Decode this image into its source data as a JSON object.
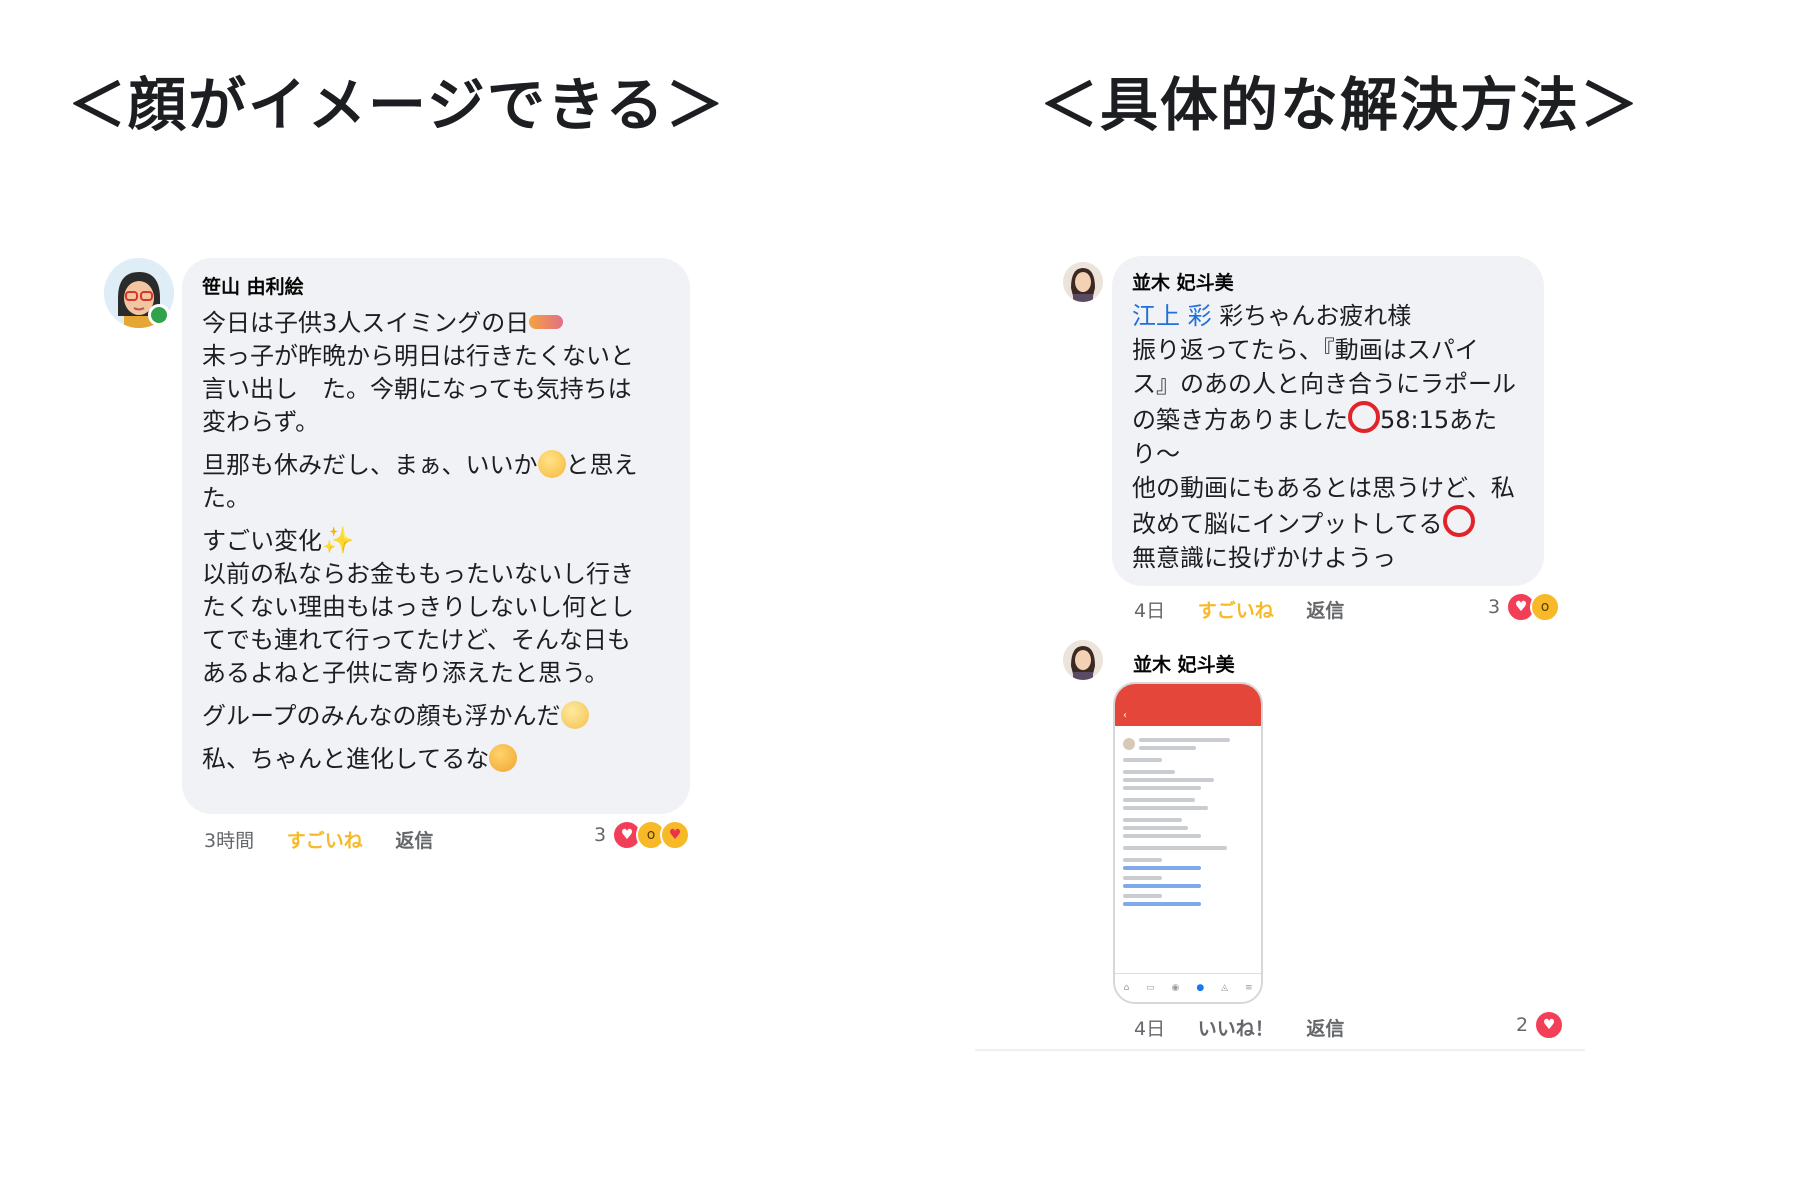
{
  "headings": {
    "left": "＜顔がイメージできる＞",
    "right": "＜具体的な解決方法＞"
  },
  "left_comment": {
    "author": "笹山 由利絵",
    "p1_l1": "今日は子供3人スイミングの日",
    "p1_l2": "末っ子が昨晩から明日は行きたくないと",
    "p1_l3": "言い出し　た。今朝になっても気持ちは",
    "p1_l4": "変わらず。",
    "p2_a": "旦那も休みだし、まぁ、いいか",
    "p2_b": "と思え",
    "p2_c": "た。",
    "p3_a": "すごい変化",
    "p3_spark": "✨",
    "p3_l2": "以前の私ならお金ももったいないし行き",
    "p3_l3": "たくない理由もはっきりしないし何とし",
    "p3_l4": "てでも連れて行ってたけど、そんな日も",
    "p3_l5": "あるよねと子供に寄り添えたと思う。",
    "p4": "グループのみんなの顔も浮かんだ",
    "p5": "私、ちゃんと進化してるな",
    "time": "3時間",
    "like": "すごいね",
    "reply": "返信",
    "reaction_count": "3"
  },
  "right_comment1": {
    "author": "並木 妃斗美",
    "mention": "江上 彩",
    "l1_rest": " 彩ちゃんお疲れ様",
    "l2": "振り返ってたら、『動画はスパイ",
    "l3": "ス』のあの人と向き合うにラポール",
    "l4_a": "の築き方ありました",
    "l4_b": "58:15あた",
    "l5": "り〜",
    "l6": "他の動画にもあるとは思うけど、私",
    "l7": "改めて脳にインプットしてる",
    "l8": "無意識に投げかけようっ",
    "time": "4日",
    "like": "すごいね",
    "reply": "返信",
    "reaction_count": "3"
  },
  "right_comment2": {
    "author": "並木 妃斗美",
    "time": "4日",
    "like": "いいね！",
    "reply": "返信",
    "reaction_count": "2"
  },
  "colors": {
    "liked": "#f7b928",
    "mention": "#216fdb",
    "bubble": "#f0f2f5",
    "phone_header": "#e4473a"
  }
}
